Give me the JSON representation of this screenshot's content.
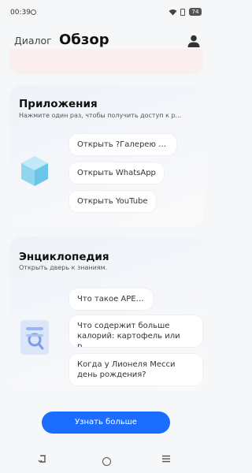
{
  "status_bar": {
    "time": "00:39",
    "battery": "74"
  },
  "header": {
    "tab_dialog": "Диалог",
    "tab_overview": "Обзор"
  },
  "apps_card": {
    "title": "Приложения",
    "subtitle": "Нажмите один раз, чтобы получить доступ к р...",
    "chips": [
      "Открыть ?Галерею AI?",
      "Открыть WhatsApp",
      "Открыть YouTube"
    ]
  },
  "encyclopedia_card": {
    "title": "Энциклопедия",
    "subtitle": "Открыть дверь к знаниям.",
    "chips": [
      "Что такое APEC?",
      "Что содержит больше калорий: картофель или р...",
      "Когда у Лионеля Месси день рождения?"
    ]
  },
  "footer": {
    "learn_more": "Узнать больше"
  },
  "colors": {
    "accent": "#1a6dff",
    "top_card": "#fbeeee"
  }
}
